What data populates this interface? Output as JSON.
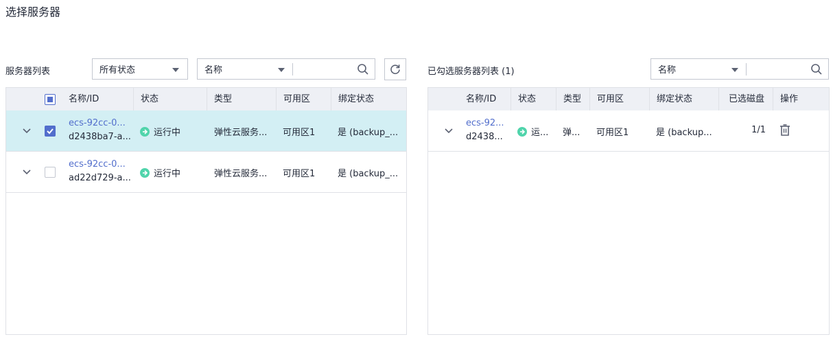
{
  "page": {
    "title": "选择服务器"
  },
  "left": {
    "label": "服务器列表",
    "status_filter": {
      "value": "所有状态"
    },
    "search_field": {
      "value": "名称"
    },
    "columns": [
      "名称/ID",
      "状态",
      "类型",
      "可用区",
      "绑定状态"
    ],
    "rows": [
      {
        "name": "ecs-92cc-0...",
        "id": "d2438ba7-a...",
        "status": "运行中",
        "type": "弹性云服务...",
        "zone": "可用区1",
        "binding": "是 (backup_..."
      },
      {
        "name": "ecs-92cc-0...",
        "id": "ad22d729-a...",
        "status": "运行中",
        "type": "弹性云服务...",
        "zone": "可用区1",
        "binding": "是 (backup_..."
      }
    ]
  },
  "right": {
    "label": "已勾选服务器列表 (1)",
    "search_field": {
      "value": "名称"
    },
    "columns": [
      "名称/ID",
      "状态",
      "类型",
      "可用区",
      "绑定状态",
      "已选磁盘",
      "操作"
    ],
    "rows": [
      {
        "name": "ecs-92...",
        "id": "d2438...",
        "status": "运...",
        "type": "弹...",
        "zone": "可用区1",
        "binding": "是 (backup...",
        "disks": "1/1"
      }
    ]
  },
  "icons": {
    "search": "search-icon",
    "refresh": "refresh-icon",
    "delete": "trash-icon",
    "expand": "chevron-down-icon",
    "status": "arrow-right-circle-icon"
  },
  "colors": {
    "link": "#526ecc",
    "status_running": "#50d4ab",
    "selected_row": "#d3eff4",
    "header_bg": "#eef0f5"
  }
}
